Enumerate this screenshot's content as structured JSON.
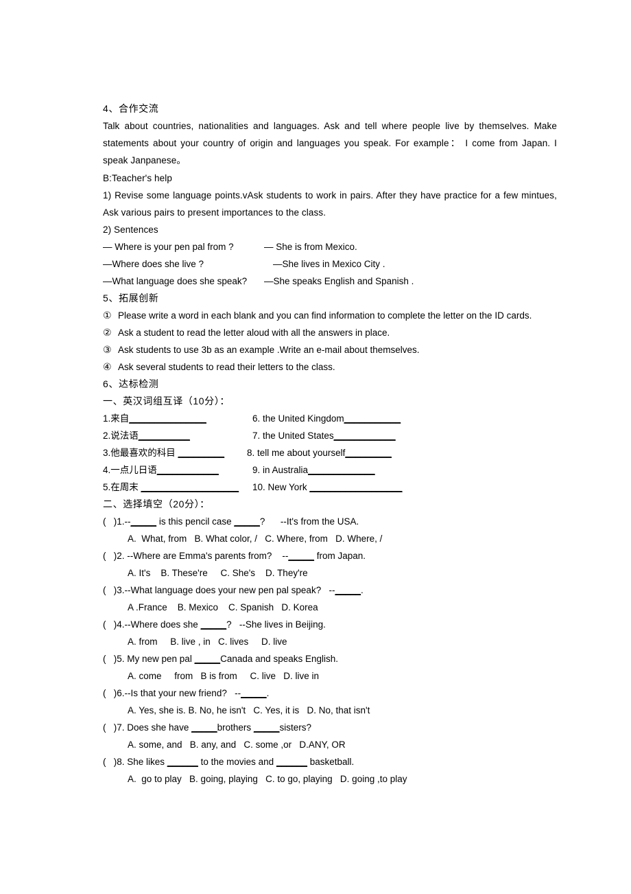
{
  "document": {
    "sections": {
      "cooperation": {
        "heading": "4、合作交流",
        "paragraph": "Talk about countries, nationalities and languages. Ask and tell where people live by themselves. Make statements about your country of origin and languages you speak. For example： I come from Japan. I speak Janpanese。",
        "teacher_help_label": "B:Teacher's help",
        "item1": "1) Revise some language points.vAsk students to work in pairs. After they have practice for a few mintues, Ask various pairs to present importances to the class.",
        "item2": "2) Sentences",
        "sentences": [
          {
            "question": "— Where is your pen pal from ?",
            "answer": "— She is from Mexico."
          },
          {
            "question": "—Where does she live ?",
            "answer": "—She lives in Mexico City ."
          },
          {
            "question": "—What language does she speak?",
            "answer": "—She speaks English and Spanish ."
          }
        ]
      },
      "innovation": {
        "heading": "5、拓展创新",
        "items": [
          {
            "marker": "①",
            "text": "Please write a word in each blank and you can find information to complete the letter on the ID cards."
          },
          {
            "marker": "②",
            "text": "Ask a student to read the letter aloud with all the answers in place."
          },
          {
            "marker": "③",
            "text": "Ask students to use 3b as an example .Write an e-mail about themselves."
          },
          {
            "marker": "④",
            "text": "Ask several students to read their letters to the class."
          }
        ]
      },
      "test": {
        "heading": "6、达标检测",
        "part_one": {
          "heading": "一、英汉词组互译（10分）：",
          "rows": [
            {
              "left_num": "1.",
              "left_text": "来自",
              "left_blank": "_______________",
              "right_num": "6.",
              "right_text": " the United Kingdom",
              "right_blank": "___________"
            },
            {
              "left_num": "2.",
              "left_text": "说法语",
              "left_blank": "__________",
              "right_num": "7.",
              "right_text": " the United States",
              "right_blank": "____________"
            },
            {
              "left_num": "3.",
              "left_text": "他最喜欢的科目 ",
              "left_blank": "_________",
              "right_num": "8.",
              "right_text": " tell me about yourself",
              "right_blank": "_________"
            },
            {
              "left_num": "4.",
              "left_text": "一点儿日语",
              "left_blank": "____________",
              "right_num": "9.",
              "right_text": " in Australia",
              "right_blank": "_____________"
            },
            {
              "left_num": "5.",
              "left_text": "在周末 ",
              "left_blank": "___________________",
              "right_num": "10.",
              "right_text": " New York ",
              "right_blank": "__________________"
            }
          ]
        },
        "part_two": {
          "heading": "二、选择填空（20分）：",
          "questions": [
            {
              "bracket": "(   )",
              "number": "1.",
              "stem_a": "--",
              "blank_a": "_____",
              "stem_b": " is this pencil case ",
              "blank_b": "_____",
              "stem_c": "?      --It's from the USA.",
              "options": "A.  What, from   B. What color, /   C. Where, from   D. Where, /"
            },
            {
              "bracket": "(   )",
              "number": "2.",
              "stem_a": " --Where are Emma's parents from?    --",
              "blank_a": "_____",
              "stem_b": " from Japan.",
              "blank_b": "",
              "stem_c": "",
              "options": "A. It's    B. These're     C. She's    D. They're"
            },
            {
              "bracket": "(   )",
              "number": "3.",
              "stem_a": "--What language does your new pen pal speak?   --",
              "blank_a": "_____",
              "stem_b": ".",
              "blank_b": "",
              "stem_c": "",
              "options": "A .France    B. Mexico    C. Spanish   D. Korea"
            },
            {
              "bracket": "(   )",
              "number": "4.",
              "stem_a": "--Where does she ",
              "blank_a": "_____",
              "stem_b": "?   --She lives in Beijing.",
              "blank_b": "",
              "stem_c": "",
              "options": "A. from     B. live , in   C. lives     D. live"
            },
            {
              "bracket": "(   )",
              "number": "5.",
              "stem_a": " My new pen pal ",
              "blank_a": "_____",
              "stem_b": "Canada and speaks English.",
              "blank_b": "",
              "stem_c": "",
              "options": "A. come     from   B is from     C. live   D. live in"
            },
            {
              "bracket": "(   )",
              "number": "6.",
              "stem_a": "--Is that your new friend?   --",
              "blank_a": "_____",
              "stem_b": ".",
              "blank_b": "",
              "stem_c": "",
              "options": "A. Yes, she is. B. No, he isn't   C. Yes, it is   D. No, that isn't"
            },
            {
              "bracket": "(   )",
              "number": "7.",
              "stem_a": " Does she have ",
              "blank_a": "_____",
              "stem_b": "brothers ",
              "blank_b": "_____",
              "stem_c": "sisters?",
              "options": "A. some, and   B. any, and   C. some ,or   D.ANY, OR"
            },
            {
              "bracket": "(   )",
              "number": "8.",
              "stem_a": " She likes ",
              "blank_a": "______",
              "stem_b": " to the movies and ",
              "blank_b": "______",
              "stem_c": " basketball.",
              "options": "A.  go to play   B. going, playing   C. to go, playing   D. going ,to play"
            }
          ]
        }
      }
    }
  }
}
